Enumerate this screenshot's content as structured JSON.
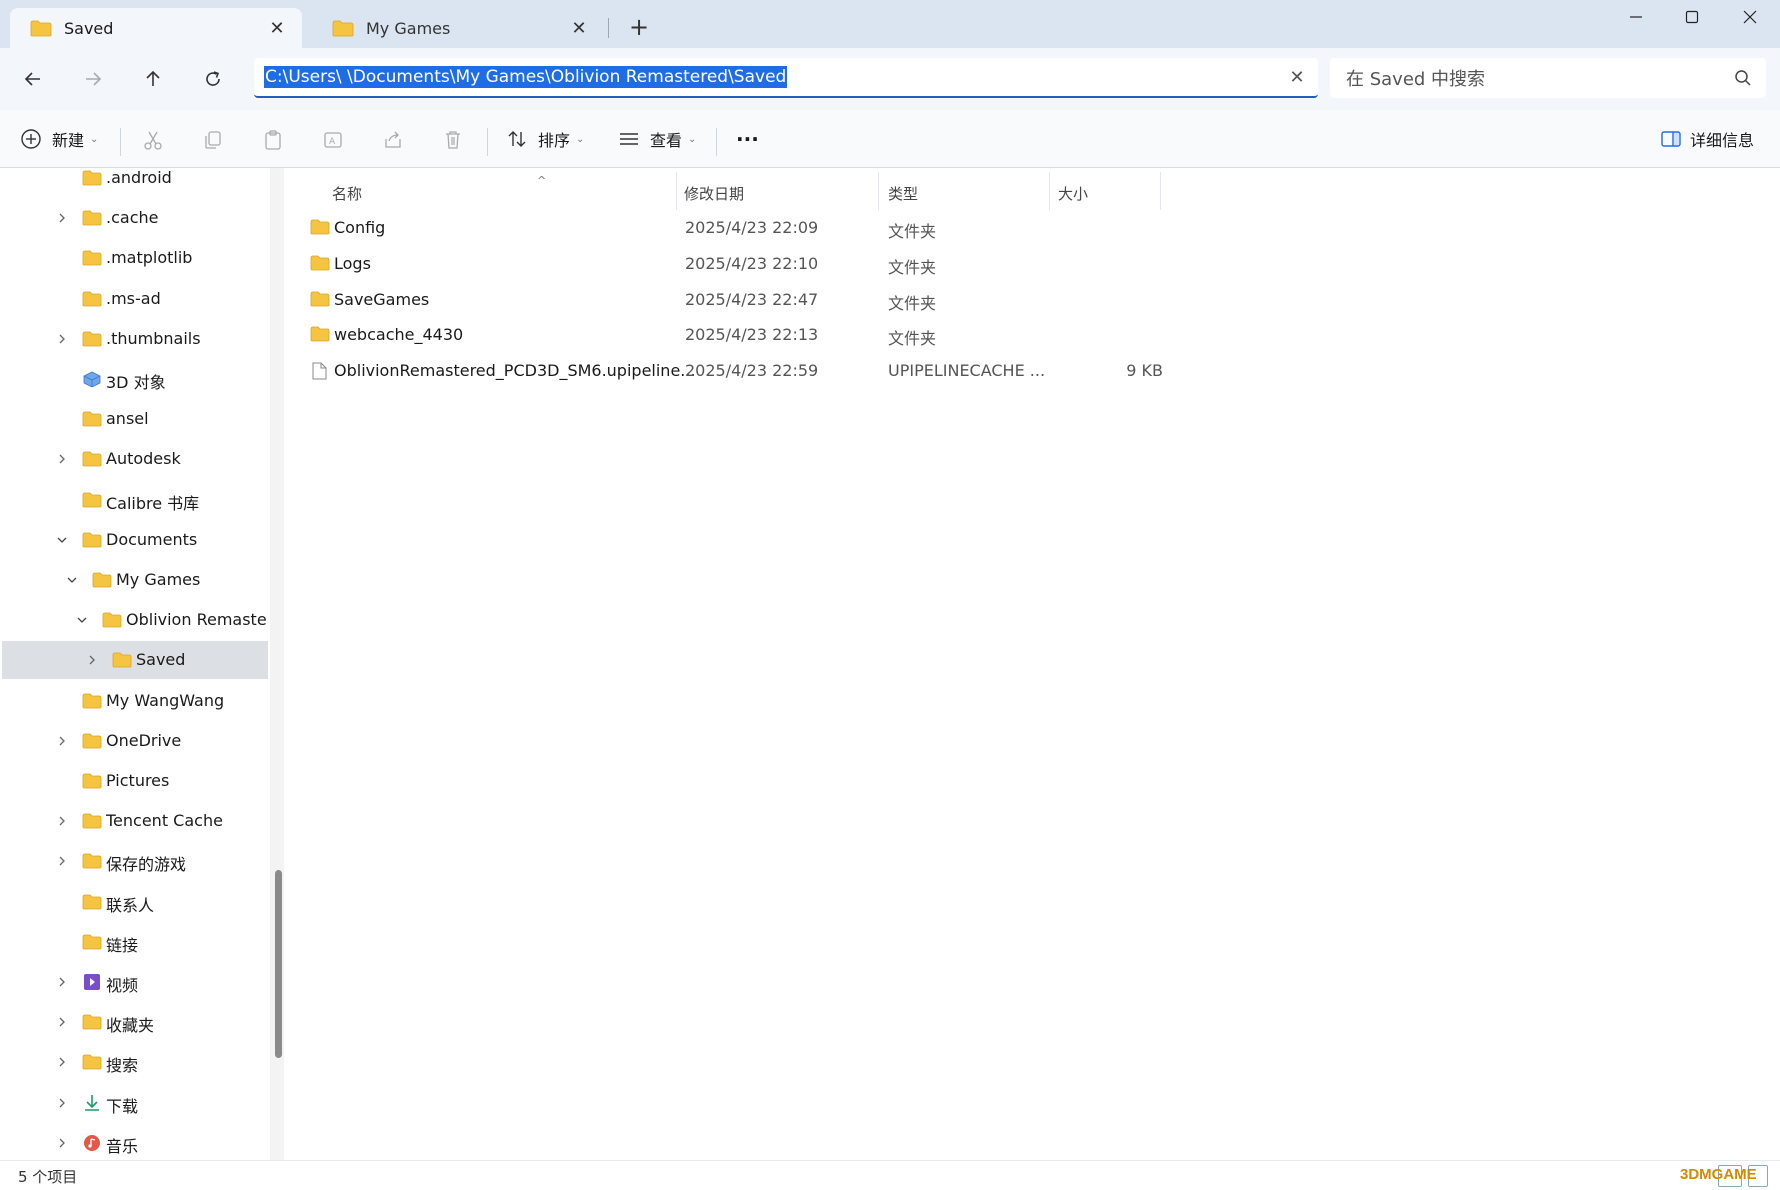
{
  "tabs": [
    {
      "label": "Saved",
      "active": true
    },
    {
      "label": "My Games",
      "active": false
    }
  ],
  "address": {
    "path": "C:\\Users\\        \\Documents\\My Games\\Oblivion Remastered\\Saved"
  },
  "search": {
    "placeholder": "在 Saved 中搜索"
  },
  "toolbar": {
    "new_label": "新建",
    "sort_label": "排序",
    "view_label": "查看",
    "more_label": "···",
    "details_label": "详细信息"
  },
  "sidebar": {
    "items": [
      {
        "label": ".android",
        "depth": 0,
        "expandable": false,
        "icon": "folder-icon"
      },
      {
        "label": ".cache",
        "depth": 0,
        "expandable": true,
        "icon": "folder-icon"
      },
      {
        "label": ".matplotlib",
        "depth": 0,
        "expandable": false,
        "icon": "folder-icon"
      },
      {
        "label": ".ms-ad",
        "depth": 0,
        "expandable": false,
        "icon": "folder-icon"
      },
      {
        "label": ".thumbnails",
        "depth": 0,
        "expandable": true,
        "icon": "folder-icon"
      },
      {
        "label": "3D 对象",
        "depth": 0,
        "expandable": false,
        "icon": "3d-objects-icon"
      },
      {
        "label": "ansel",
        "depth": 0,
        "expandable": false,
        "icon": "folder-icon"
      },
      {
        "label": "Autodesk",
        "depth": 0,
        "expandable": true,
        "icon": "folder-icon"
      },
      {
        "label": "Calibre 书库",
        "depth": 0,
        "expandable": false,
        "icon": "folder-icon"
      },
      {
        "label": "Documents",
        "depth": 0,
        "expandable": true,
        "expanded": true,
        "icon": "folder-icon"
      },
      {
        "label": "My Games",
        "depth": 1,
        "expandable": true,
        "expanded": true,
        "icon": "folder-icon"
      },
      {
        "label": "Oblivion Remastered",
        "depth": 2,
        "expandable": true,
        "expanded": true,
        "icon": "folder-icon"
      },
      {
        "label": "Saved",
        "depth": 3,
        "expandable": true,
        "selected": true,
        "icon": "folder-icon"
      },
      {
        "label": "My WangWang",
        "depth": 0,
        "expandable": false,
        "icon": "folder-icon"
      },
      {
        "label": "OneDrive",
        "depth": 0,
        "expandable": true,
        "icon": "folder-icon"
      },
      {
        "label": "Pictures",
        "depth": 0,
        "expandable": false,
        "icon": "folder-icon"
      },
      {
        "label": "Tencent Cache",
        "depth": 0,
        "expandable": true,
        "icon": "folder-icon"
      },
      {
        "label": "保存的游戏",
        "depth": 0,
        "expandable": true,
        "icon": "folder-icon"
      },
      {
        "label": "联系人",
        "depth": 0,
        "expandable": false,
        "icon": "folder-icon"
      },
      {
        "label": "链接",
        "depth": 0,
        "expandable": false,
        "icon": "folder-icon"
      },
      {
        "label": "视频",
        "depth": 0,
        "expandable": true,
        "icon": "video-icon"
      },
      {
        "label": "收藏夹",
        "depth": 0,
        "expandable": true,
        "icon": "folder-icon"
      },
      {
        "label": "搜索",
        "depth": 0,
        "expandable": true,
        "icon": "folder-icon"
      },
      {
        "label": "下载",
        "depth": 0,
        "expandable": true,
        "icon": "download-icon"
      },
      {
        "label": "音乐",
        "depth": 0,
        "expandable": true,
        "icon": "music-icon"
      }
    ]
  },
  "list": {
    "columns": {
      "name": "名称",
      "date": "修改日期",
      "type": "类型",
      "size": "大小"
    },
    "rows": [
      {
        "name": "Config",
        "date": "2025/4/23 22:09",
        "type": "文件夹",
        "size": "",
        "icon": "folder-icon"
      },
      {
        "name": "Logs",
        "date": "2025/4/23 22:10",
        "type": "文件夹",
        "size": "",
        "icon": "folder-icon"
      },
      {
        "name": "SaveGames",
        "date": "2025/4/23 22:47",
        "type": "文件夹",
        "size": "",
        "icon": "folder-icon"
      },
      {
        "name": "webcache_4430",
        "date": "2025/4/23 22:13",
        "type": "文件夹",
        "size": "",
        "icon": "folder-icon"
      },
      {
        "name": "OblivionRemastered_PCD3D_SM6.upipeline...",
        "date": "2025/4/23 22:59",
        "type": "UPIPELINECACHE ...",
        "size": "9 KB",
        "icon": "file-icon"
      }
    ]
  },
  "status": {
    "item_count": "5 个项目"
  },
  "watermark": {
    "text": "3DMGAME"
  },
  "colors": {
    "accent": "#1e6de6",
    "folder": "#f5c542",
    "selected_row": "#dcdfe4"
  }
}
